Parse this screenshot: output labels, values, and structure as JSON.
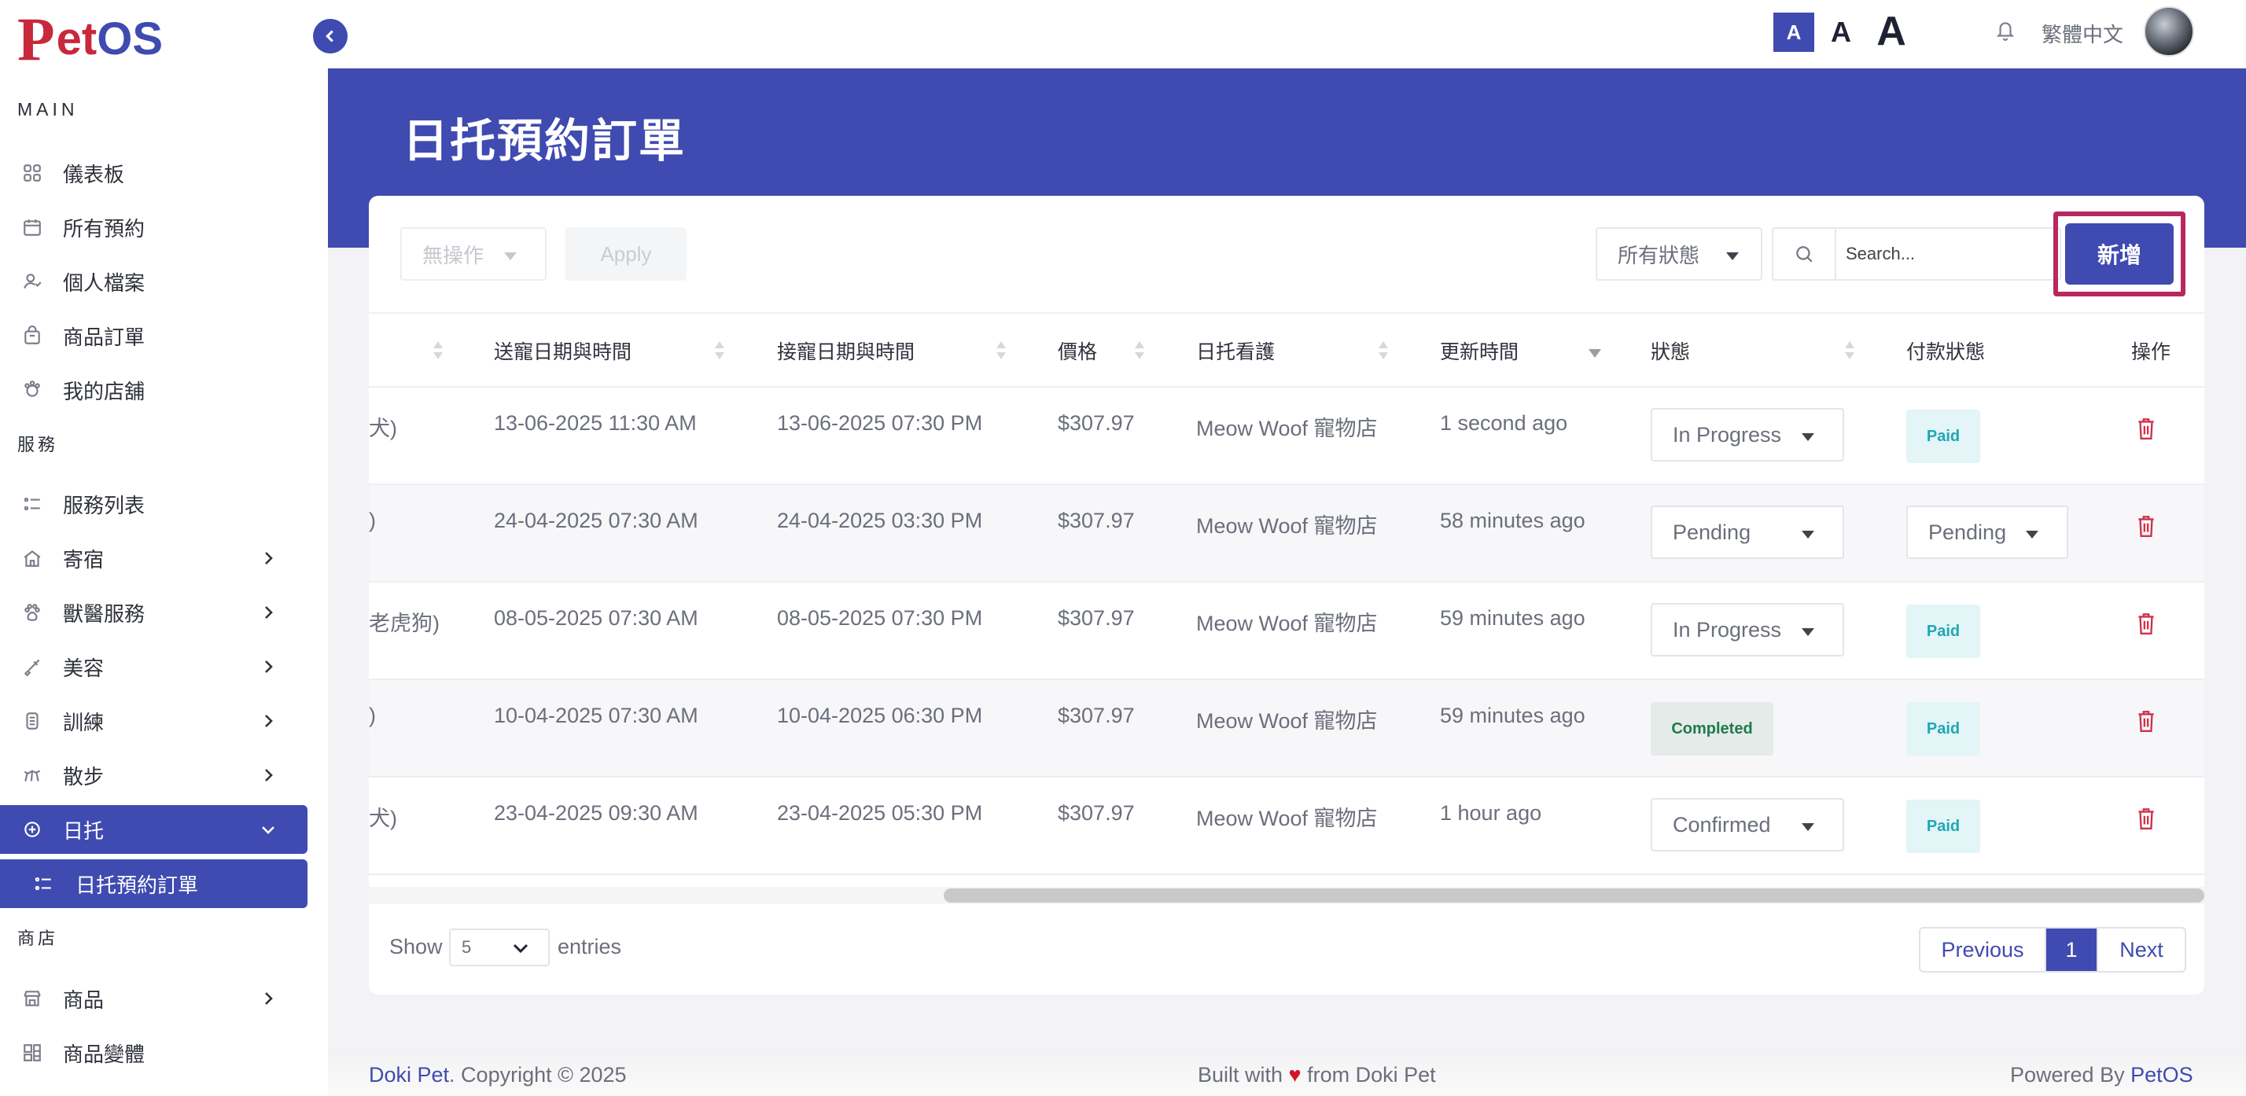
{
  "brand": {
    "logo_p": "P",
    "logo_et": "et",
    "logo_os": "OS"
  },
  "sidebar": {
    "sections": {
      "main": "MAIN",
      "services": "服務",
      "shop": "商店"
    },
    "main_items": [
      {
        "label": "儀表板",
        "icon": "dashboard-icon"
      },
      {
        "label": "所有預約",
        "icon": "calendar-icon"
      },
      {
        "label": "個人檔案",
        "icon": "user-icon"
      },
      {
        "label": "商品訂單",
        "icon": "bag-icon"
      },
      {
        "label": "我的店舖",
        "icon": "store-icon"
      }
    ],
    "service_items": [
      {
        "label": "服務列表",
        "icon": "list-icon"
      },
      {
        "label": "寄宿",
        "icon": "house-icon"
      },
      {
        "label": "獸醫服務",
        "icon": "paw-icon"
      },
      {
        "label": "美容",
        "icon": "brush-icon"
      },
      {
        "label": "訓練",
        "icon": "training-icon"
      },
      {
        "label": "散步",
        "icon": "walk-icon"
      },
      {
        "label": "日托",
        "icon": "daycare-icon"
      }
    ],
    "sub_item": {
      "label": "日托預約訂單",
      "icon": "list-icon"
    },
    "shop_items": [
      {
        "label": "商品",
        "icon": "shop-icon"
      },
      {
        "label": "商品變體",
        "icon": "variant-icon"
      }
    ]
  },
  "topbar": {
    "font_small": "A",
    "font_mid": "A",
    "font_big": "A",
    "language": "繁體中文"
  },
  "page": {
    "title": "日托預約訂單"
  },
  "toolbar": {
    "bulk_action": "無操作",
    "apply_label": "Apply",
    "status_filter": "所有狀態",
    "search_placeholder": "Search...",
    "add_label": "新增"
  },
  "table": {
    "headers": [
      "送寵日期與時間",
      "接寵日期與時間",
      "價格",
      "日托看護",
      "更新時間",
      "狀態",
      "付款狀態",
      "操作"
    ],
    "rows": [
      {
        "pet": "犬)",
        "dropoff": "13-06-2025 11:30 AM",
        "pickup": "13-06-2025 07:30 PM",
        "price": "$307.97",
        "caregiver": "Meow Woof 寵物店",
        "updated": "1 second ago",
        "status": "In Progress",
        "status_type": "select",
        "payment": "Paid",
        "payment_type": "badge"
      },
      {
        "pet": ")",
        "dropoff": "24-04-2025 07:30 AM",
        "pickup": "24-04-2025 03:30 PM",
        "price": "$307.97",
        "caregiver": "Meow Woof 寵物店",
        "updated": "58 minutes ago",
        "status": "Pending",
        "status_type": "select",
        "payment": "Pending",
        "payment_type": "select"
      },
      {
        "pet": "老虎狗)",
        "dropoff": "08-05-2025 07:30 AM",
        "pickup": "08-05-2025 07:30 PM",
        "price": "$307.97",
        "caregiver": "Meow Woof 寵物店",
        "updated": "59 minutes ago",
        "status": "In Progress",
        "status_type": "select",
        "payment": "Paid",
        "payment_type": "badge"
      },
      {
        "pet": ")",
        "dropoff": "10-04-2025 07:30 AM",
        "pickup": "10-04-2025 06:30 PM",
        "price": "$307.97",
        "caregiver": "Meow Woof 寵物店",
        "updated": "59 minutes ago",
        "status": "Completed",
        "status_type": "badge",
        "payment": "Paid",
        "payment_type": "badge"
      },
      {
        "pet": "犬)",
        "dropoff": "23-04-2025 09:30 AM",
        "pickup": "23-04-2025 05:30 PM",
        "price": "$307.97",
        "caregiver": "Meow Woof 寵物店",
        "updated": "1 hour ago",
        "status": "Confirmed",
        "status_type": "select",
        "payment": "Paid",
        "payment_type": "badge"
      }
    ]
  },
  "pagination": {
    "show_label": "Show",
    "page_size": "5",
    "entries_label": "entries",
    "prev_label": "Previous",
    "current_page": "1",
    "next_label": "Next"
  },
  "footer": {
    "brand": "Doki Pet",
    "copyright": ". Copyright © 2025",
    "built_prefix": "Built with ",
    "heart": "♥",
    "built_suffix": " from Doki Pet",
    "powered_prefix": "Powered By ",
    "powered_brand": "PetOS"
  },
  "colors": {
    "primary": "#3f4bb0",
    "logo_red": "#c8283c",
    "highlight": "#b8285e",
    "danger": "#d0304a"
  }
}
